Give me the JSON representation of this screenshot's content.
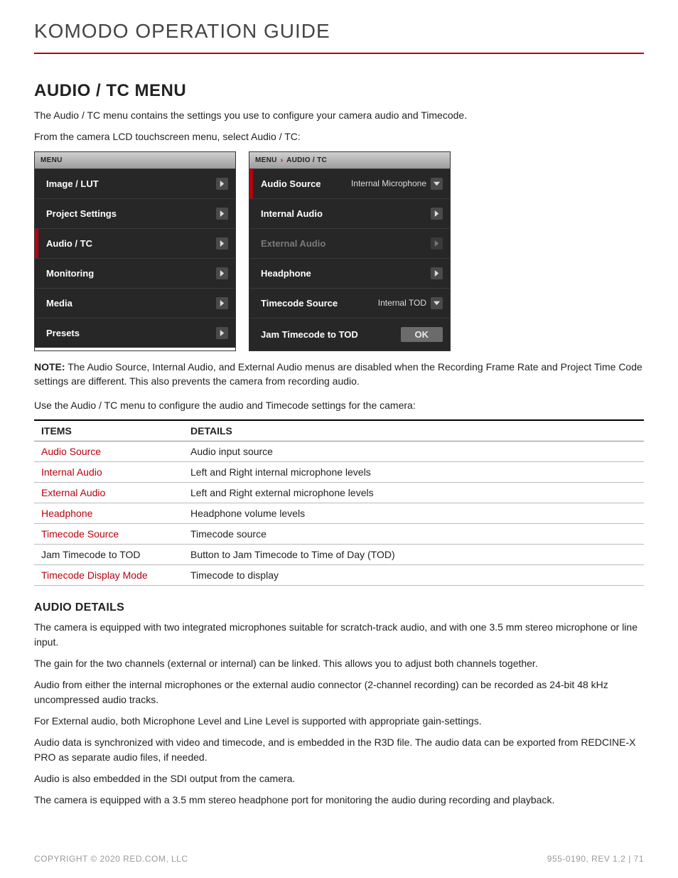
{
  "header": {
    "title": "KOMODO OPERATION GUIDE"
  },
  "section": {
    "heading": "AUDIO / TC MENU",
    "intro1": "The Audio / TC menu contains the settings you use to configure your camera audio and Timecode.",
    "intro2": "From the camera LCD touchscreen menu, select Audio / TC:"
  },
  "menu_left": {
    "header": "MENU",
    "items": [
      {
        "label": "Image / LUT"
      },
      {
        "label": "Project Settings"
      },
      {
        "label": "Audio / TC",
        "selected": true
      },
      {
        "label": "Monitoring"
      },
      {
        "label": "Media"
      },
      {
        "label": "Presets"
      }
    ]
  },
  "menu_right": {
    "bc_root": "MENU",
    "bc_leaf": "AUDIO / TC",
    "items": [
      {
        "label": "Audio Source",
        "value": "Internal Microphone",
        "type": "dropdown",
        "selected": true
      },
      {
        "label": "Internal Audio",
        "type": "arrow"
      },
      {
        "label": "External Audio",
        "type": "arrow",
        "disabled": true
      },
      {
        "label": "Headphone",
        "type": "arrow"
      },
      {
        "label": "Timecode Source",
        "value": "Internal TOD",
        "type": "dropdown"
      },
      {
        "label": "Jam Timecode to TOD",
        "type": "ok",
        "ok": "OK"
      }
    ]
  },
  "note": {
    "prefix": "NOTE:",
    "text": " The Audio Source, Internal Audio, and External Audio menus are disabled when the Recording Frame Rate and Project Time Code settings are different. This also prevents the camera from recording audio."
  },
  "use_text": "Use the Audio / TC menu to configure the audio and Timecode settings for the camera:",
  "table": {
    "head_items": "ITEMS",
    "head_details": "DETAILS",
    "rows": [
      {
        "item": "Audio Source",
        "link": true,
        "detail": "Audio input source"
      },
      {
        "item": "Internal Audio",
        "link": true,
        "detail": "Left and Right internal microphone levels"
      },
      {
        "item": "External Audio",
        "link": true,
        "detail": "Left and Right external microphone levels"
      },
      {
        "item": "Headphone",
        "link": true,
        "detail": "Headphone volume levels"
      },
      {
        "item": "Timecode Source",
        "link": true,
        "detail": "Timecode source"
      },
      {
        "item": "Jam Timecode to TOD",
        "link": false,
        "detail": "Button to Jam Timecode to Time of Day (TOD)"
      },
      {
        "item": "Timecode Display Mode",
        "link": true,
        "detail": "Timecode to display"
      }
    ]
  },
  "audio_details": {
    "heading": "AUDIO DETAILS",
    "p1": "The camera is equipped with two integrated microphones suitable for scratch-track audio, and with one 3.5 mm stereo microphone or line input.",
    "p2": "The gain for the two channels (external or internal) can be linked. This allows you to adjust both channels together.",
    "p3": "Audio from either the internal microphones or the external audio connector (2-channel recording) can be recorded as 24-bit 48 kHz uncompressed audio tracks.",
    "p4": "For External audio, both Microphone Level and Line Level is supported with appropriate gain-settings.",
    "p5": "Audio data is synchronized with video and timecode, and is embedded in the R3D file. The audio data can be exported from REDCINE-X PRO as separate audio files, if needed.",
    "p6": "Audio is also embedded in the SDI output from the camera.",
    "p7": "The camera is equipped with a 3.5 mm stereo headphone port for monitoring the audio during recording and playback."
  },
  "footer": {
    "left": "COPYRIGHT © 2020 RED.COM, LLC",
    "right": "955-0190, REV 1.2  |  71"
  }
}
